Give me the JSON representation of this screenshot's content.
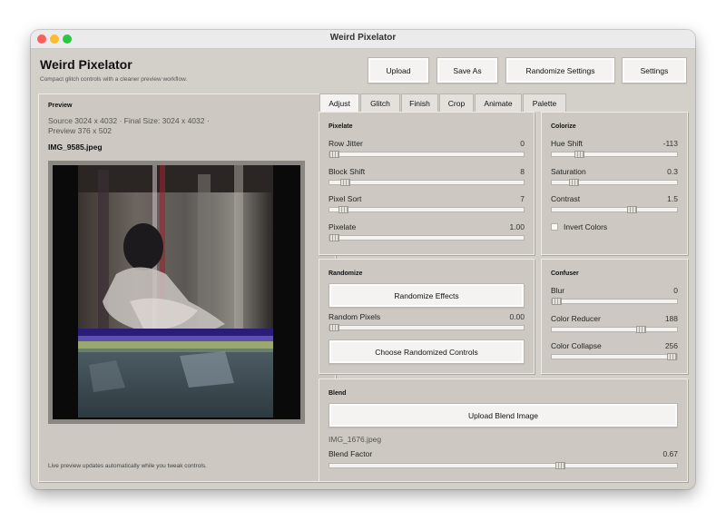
{
  "window": {
    "title": "Weird Pixelator"
  },
  "header": {
    "title": "Weird Pixelator",
    "subtitle": "Compact glitch controls with a cleaner preview workflow."
  },
  "toolbar": {
    "upload": "Upload",
    "save_as": "Save As",
    "randomize_settings": "Randomize Settings",
    "settings": "Settings"
  },
  "preview": {
    "title": "Preview",
    "info_line1": "Source 3024 x 4032 · Final Size: 3024 x 4032 ·",
    "info_line2": "Preview 376 x 502",
    "filename": "IMG_9585.jpeg",
    "footer": "Live preview updates automatically while you tweak controls."
  },
  "tabs": [
    "Adjust",
    "Glitch",
    "Finish",
    "Crop",
    "Animate",
    "Palette"
  ],
  "active_tab": "Adjust",
  "pixelate": {
    "title": "Pixelate",
    "controls": [
      {
        "label": "Row Jitter",
        "value": "0",
        "level": 0.0
      },
      {
        "label": "Block Shift",
        "value": "8",
        "level": 0.06
      },
      {
        "label": "Pixel Sort",
        "value": "7",
        "level": 0.05
      },
      {
        "label": "Pixelate",
        "value": "1.00",
        "level": 0.0
      }
    ]
  },
  "colorize": {
    "title": "Colorize",
    "controls": [
      {
        "label": "Hue Shift",
        "value": "-113",
        "level": 0.2
      },
      {
        "label": "Saturation",
        "value": "0.3",
        "level": 0.15
      },
      {
        "label": "Contrast",
        "value": "1.5",
        "level": 0.65
      }
    ],
    "invert_label": "Invert Colors",
    "invert_checked": false
  },
  "randomize": {
    "title": "Randomize",
    "effects_button": "Randomize Effects",
    "random_pixels_label": "Random Pixels",
    "random_pixels_value": "0.00",
    "random_pixels_level": 0.0,
    "choose_button": "Choose Randomized Controls"
  },
  "confuser": {
    "title": "Confuser",
    "controls": [
      {
        "label": "Blur",
        "value": "0",
        "level": 0.0
      },
      {
        "label": "Color Reducer",
        "value": "188",
        "level": 0.73
      },
      {
        "label": "Color Collapse",
        "value": "256",
        "level": 1.0
      }
    ]
  },
  "blend": {
    "title": "Blend",
    "upload_button": "Upload Blend Image",
    "filename": "IMG_1676.jpeg",
    "factor_label": "Blend Factor",
    "factor_value": "0.67",
    "factor_level": 0.67
  },
  "colors": {
    "window_bg": "#d3cfc9",
    "panel_bg": "#cdc9c2",
    "titlebar_bg": "#ebebeb"
  }
}
